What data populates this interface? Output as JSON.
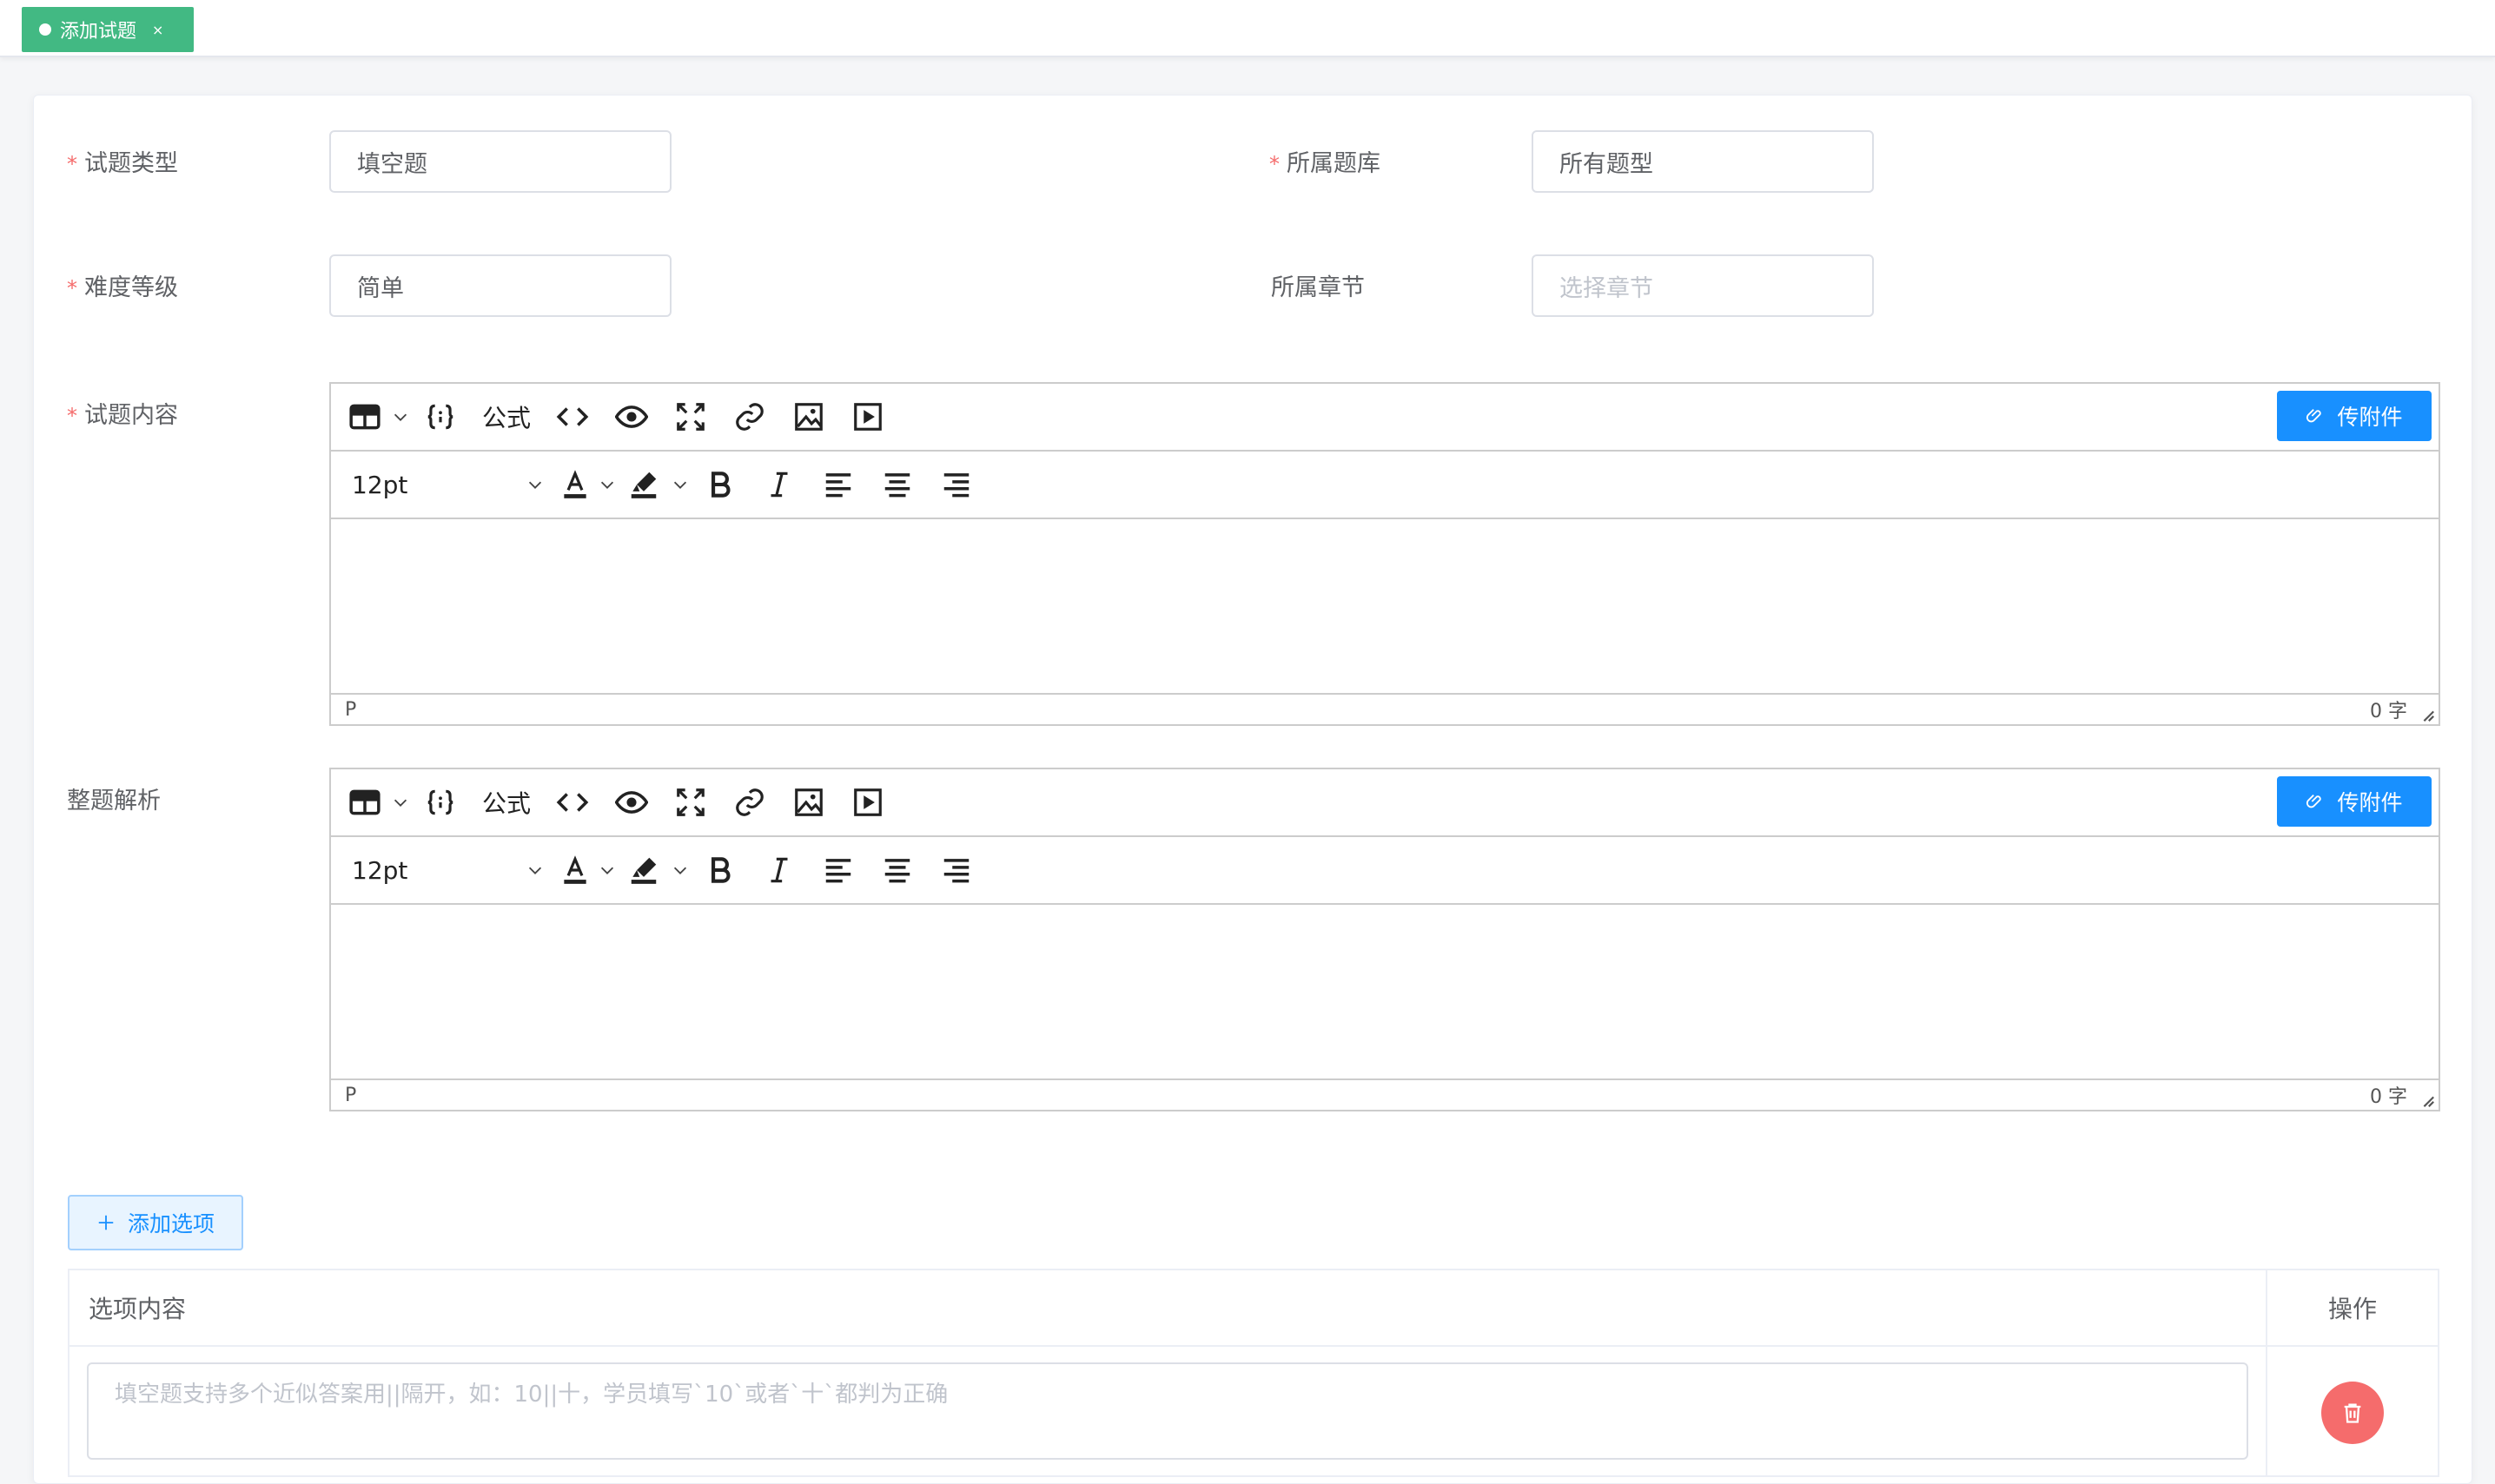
{
  "tab": {
    "label": "添加试题",
    "close": "×"
  },
  "form": {
    "type_label": "试题类型",
    "type_value": "填空题",
    "bank_label": "所属题库",
    "bank_value": "所有题型",
    "level_label": "难度等级",
    "level_value": "简单",
    "chapter_label": "所属章节",
    "chapter_placeholder": "选择章节",
    "content_label": "试题内容",
    "analysis_label": "整题解析",
    "required_mark": "*"
  },
  "editor": {
    "formula_label": "公式",
    "attach_label": "传附件",
    "font_size": "12pt",
    "path": "P",
    "word_count": "0 字",
    "icons": [
      "table-icon",
      "braces-icon",
      "code-icon",
      "preview-eye-icon",
      "fullscreen-icon",
      "link-icon",
      "image-icon",
      "video-icon",
      "font-color-icon",
      "highlight-icon",
      "bold-icon",
      "italic-icon",
      "align-left-icon",
      "align-center-icon",
      "align-right-icon"
    ]
  },
  "options": {
    "add_label": "添加选项",
    "col_content": "选项内容",
    "col_action": "操作",
    "row_placeholder": "填空题支持多个近似答案用||隔开，如：10||十，学员填写`10`或者`十`都判为正确"
  },
  "colors": {
    "tag": "#42b983",
    "primary": "#1890ff",
    "danger": "#f56c6c"
  }
}
